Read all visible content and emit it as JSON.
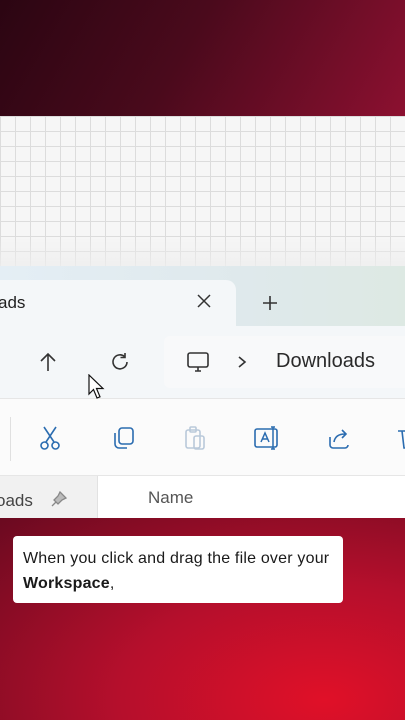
{
  "explorer": {
    "tab_label": "ads",
    "close_icon": "close-icon",
    "new_tab_icon": "plus-icon",
    "nav": {
      "up_icon": "arrow-up-icon",
      "refresh_icon": "refresh-icon",
      "pc_icon": "monitor-icon",
      "chevron_icon": "chevron-right-icon",
      "location": "Downloads"
    },
    "toolbar": {
      "icons": [
        "cut-icon",
        "copy-icon",
        "paste-icon",
        "rename-icon",
        "share-icon",
        "delete-icon"
      ]
    },
    "quick_access_item": "oads",
    "pin_icon": "pin-icon",
    "column_header": "Name"
  },
  "caption": {
    "text_before": "When you click and drag the file over your ",
    "bold": "Workspace",
    "text_after": ","
  },
  "colors": {
    "background_dark": "#2b0512",
    "background_red": "#d0102a",
    "accent_blue": "#2b6cb0"
  }
}
